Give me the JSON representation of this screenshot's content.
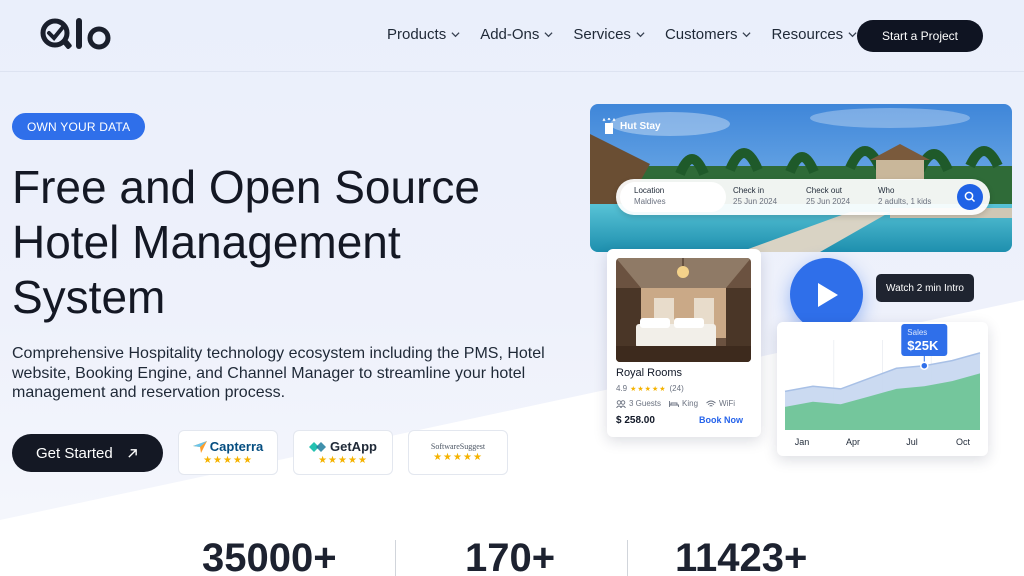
{
  "header": {
    "logo_text": "Qloapps",
    "nav": [
      {
        "label": "Products"
      },
      {
        "label": "Add-Ons"
      },
      {
        "label": "Services"
      },
      {
        "label": "Customers"
      },
      {
        "label": "Resources"
      }
    ],
    "cta": "Start a Project"
  },
  "hero": {
    "badge": "OWN YOUR DATA",
    "title": "Free and Open Source Hotel Management System",
    "description": "Comprehensive Hospitality technology ecosystem including the PMS, Hotel website, Booking Engine, and Channel Manager to streamline your hotel management and reservation process.",
    "get_started": "Get Started",
    "reviews": [
      {
        "name": "Capterra",
        "stars": "★★★★★"
      },
      {
        "name": "GetApp",
        "stars": "★★★★★"
      },
      {
        "name": "SoftwareSuggest",
        "stars": "★★★★★"
      }
    ]
  },
  "booking_widget": {
    "brand": "Hut Stay",
    "fields": [
      {
        "label": "Location",
        "value": "Maldives"
      },
      {
        "label": "Check in",
        "value": "25 Jun 2024"
      },
      {
        "label": "Check out",
        "value": "25 Jun 2024"
      },
      {
        "label": "Who",
        "value": "2 adults, 1 kids"
      }
    ]
  },
  "room_card": {
    "title": "Royal Rooms",
    "rating": "4.9",
    "stars": "★★★★★",
    "reviews": "(24)",
    "features": [
      "3 Guests",
      "King",
      "WiFi"
    ],
    "price": "$ 258.00",
    "book_now": "Book Now"
  },
  "video": {
    "intro_label": "Watch 2 min Intro"
  },
  "chart_data": {
    "type": "area",
    "categories": [
      "Jan",
      "Apr",
      "Jul",
      "Oct"
    ],
    "tooltip_label": "Sales",
    "tooltip_value": "$25K",
    "series": [
      {
        "values": [
          15,
          17,
          16,
          20,
          24,
          25,
          27,
          30
        ]
      },
      {
        "values": [
          9,
          11,
          10,
          13,
          16,
          17,
          19,
          22
        ]
      }
    ],
    "highlight_index": 5,
    "ylim": [
      0,
      35
    ]
  },
  "stats": [
    "35000+",
    "170+",
    "11423+"
  ],
  "colors": {
    "accent": "#2f6fea",
    "dark": "#141824",
    "green": "#5fbf8c"
  }
}
